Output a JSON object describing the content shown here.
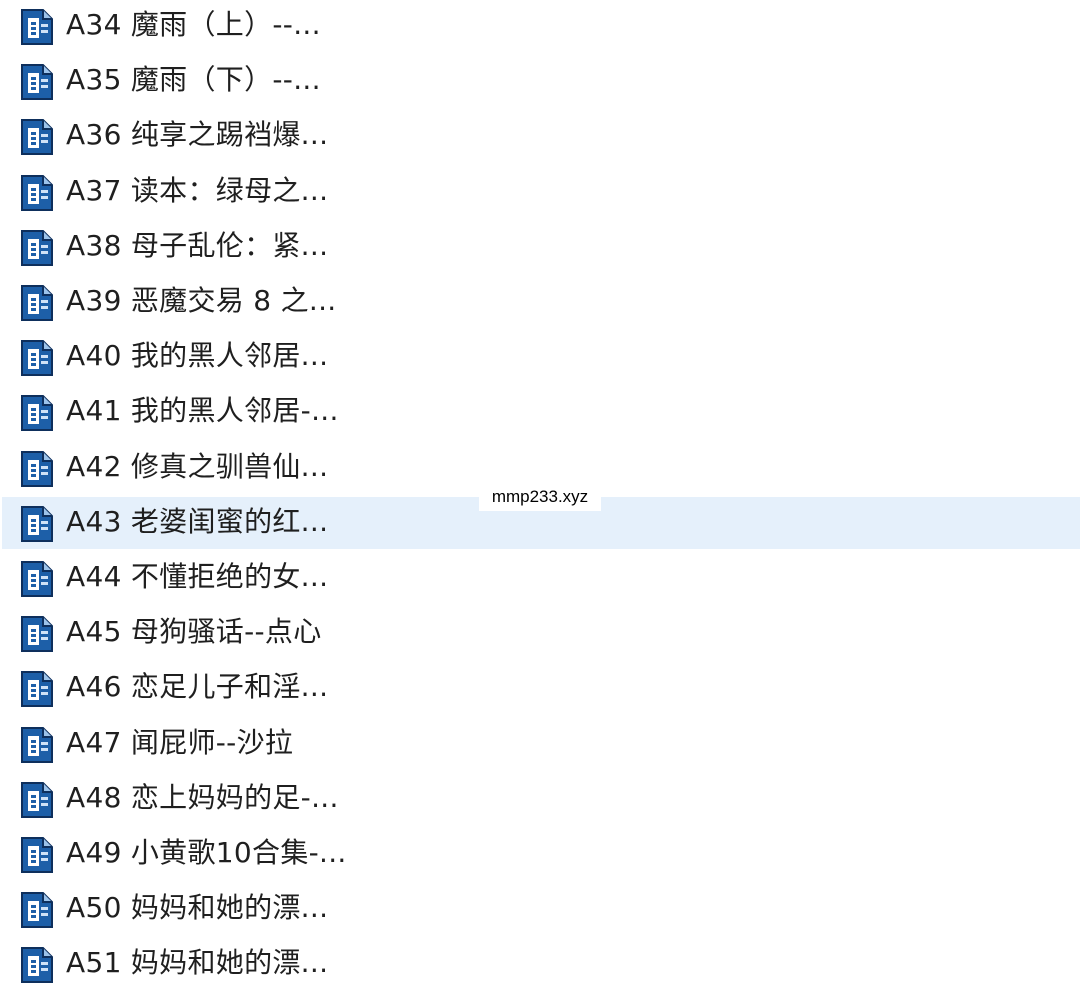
{
  "files": [
    {
      "name": "A34 魔雨（上）--...",
      "icon": "document-file-icon"
    },
    {
      "name": "A35 魔雨（下）--...",
      "icon": "document-file-icon"
    },
    {
      "name": "A36  纯享之踢裆爆...",
      "icon": "document-file-icon"
    },
    {
      "name": "A37 读本：绿母之...",
      "icon": "document-file-icon"
    },
    {
      "name": "A38 母子乱伦：紧...",
      "icon": "document-file-icon"
    },
    {
      "name": "A39 恶魔交易 8 之...",
      "icon": "document-file-icon"
    },
    {
      "name": "A40 我的黑人邻居...",
      "icon": "document-file-icon"
    },
    {
      "name": "A41 我的黑人邻居-...",
      "icon": "document-file-icon"
    },
    {
      "name": "A42 修真之驯兽仙...",
      "icon": "document-file-icon"
    },
    {
      "name": "A43 老婆闺蜜的红...",
      "icon": "document-file-icon",
      "selected": true
    },
    {
      "name": "A44 不懂拒绝的女...",
      "icon": "document-file-icon"
    },
    {
      "name": "A45 母狗骚话--点心",
      "icon": "document-file-icon"
    },
    {
      "name": "A46 恋足儿子和淫...",
      "icon": "document-file-icon"
    },
    {
      "name": "A47 闻屁师--沙拉",
      "icon": "document-file-icon"
    },
    {
      "name": "A48 恋上妈妈的足-...",
      "icon": "document-file-icon"
    },
    {
      "name": "A49 小黄歌10合集-...",
      "icon": "document-file-icon"
    },
    {
      "name": "A50 妈妈和她的漂...",
      "icon": "document-file-icon"
    },
    {
      "name": "A51 妈妈和她的漂...",
      "icon": "document-file-icon"
    }
  ],
  "watermark": {
    "text": "mmp233.xyz"
  },
  "colors": {
    "selection_background": "#e5f0fb",
    "icon_blue": "#1d5fa8",
    "icon_dark": "#0e2f5c",
    "text": "#1f1f1f"
  }
}
